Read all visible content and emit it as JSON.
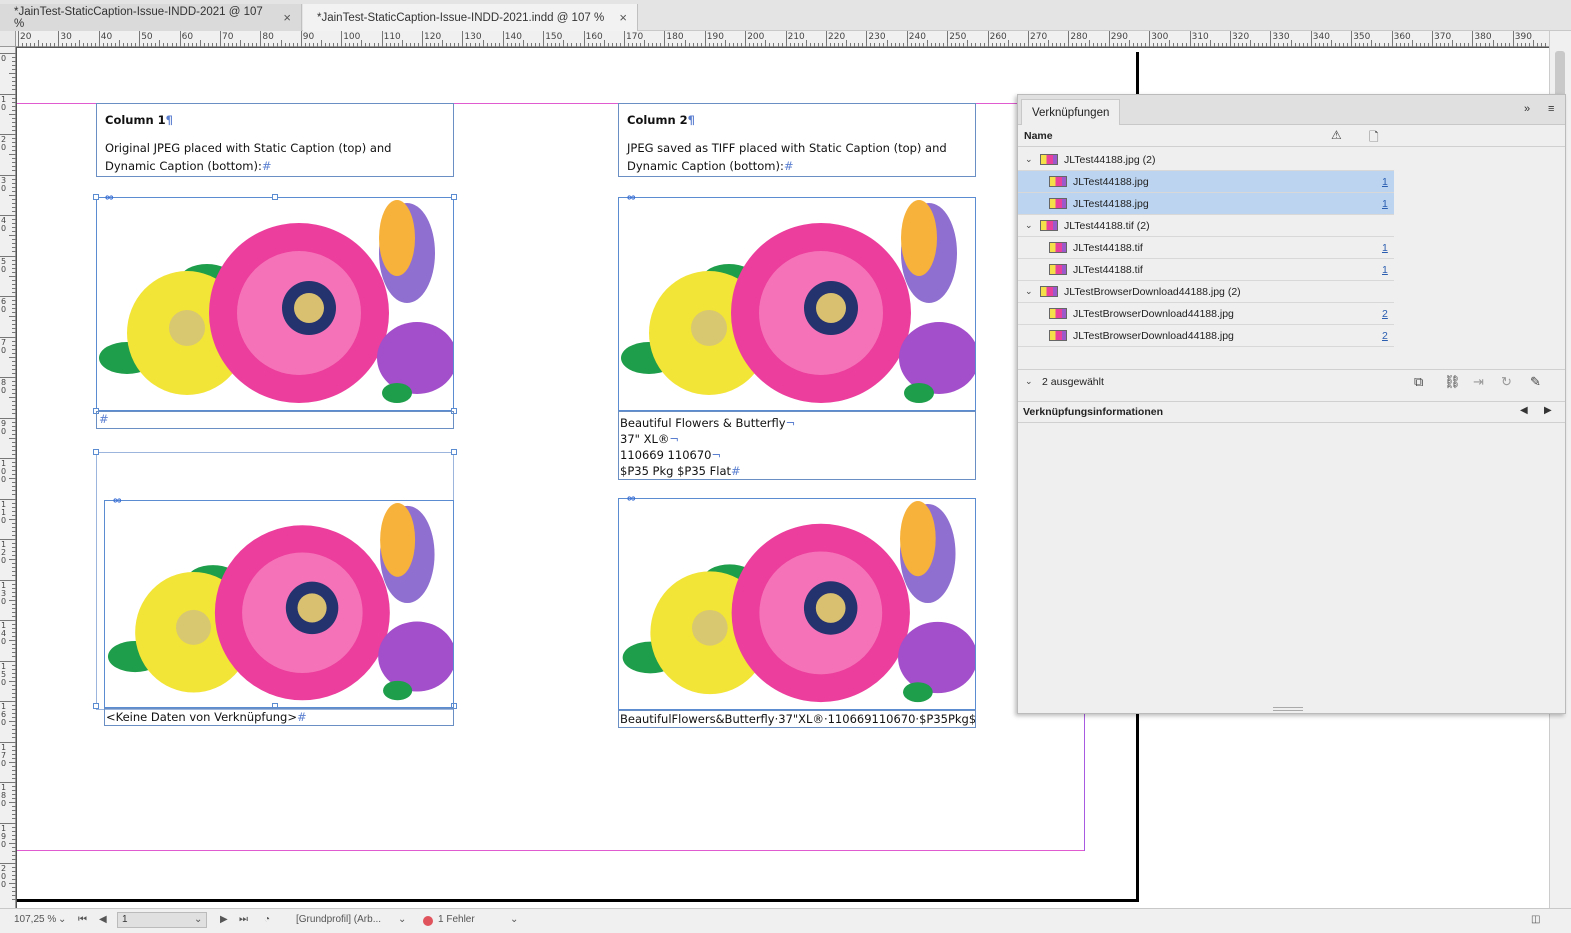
{
  "tabs": [
    {
      "title": "*JainTest-StaticCaption-Issue-INDD-2021 @ 107 %",
      "close": "×"
    },
    {
      "title": "*JainTest-StaticCaption-Issue-INDD-2021.indd @ 107 %",
      "close": "×"
    }
  ],
  "ruler": {
    "h_labels": [
      "20",
      "30",
      "40",
      "50",
      "60",
      "70",
      "80",
      "90",
      "100",
      "110",
      "120",
      "130",
      "140",
      "150",
      "160",
      "170",
      "180",
      "190",
      "200",
      "210",
      "220",
      "230",
      "240",
      "250",
      "260",
      "270",
      "280",
      "290",
      "300",
      "310",
      "320",
      "330",
      "340",
      "350",
      "360",
      "370",
      "380",
      "390"
    ],
    "v_labels": [
      "0",
      "1\n0",
      "2\n0",
      "3\n0",
      "4\n0",
      "5\n0",
      "6\n0",
      "7\n0",
      "8\n0",
      "9\n0",
      "1\n0\n0",
      "1\n1\n0",
      "1\n2\n0",
      "1\n3\n0",
      "1\n4\n0",
      "1\n5\n0",
      "1\n6\n0",
      "1\n7\n0",
      "1\n8\n0",
      "1\n9\n0",
      "2\n0\n0"
    ]
  },
  "document": {
    "col1": {
      "heading": "Column 1",
      "body": "Original JPEG placed with Static Caption (top) and Dynamic Caption (bottom):",
      "static_caption": "#",
      "dynamic_caption": "<Keine Daten von Verknüpfung>"
    },
    "col2": {
      "heading": "Column 2",
      "body": "JPEG saved as TIFF placed with Static Caption (top) and Dynamic Caption (bottom):",
      "static_caption_lines": [
        "Beautiful Flowers & Butterfly",
        "37\" XL®",
        "110669 110670",
        "$P35 Pkg $P35 Flat"
      ],
      "dynamic_caption": "BeautifulFlowers&Butterfly·37\"XL®·110669110670·$P35Pkg$P35Flat"
    }
  },
  "links_panel": {
    "title": "Verknüpfungen",
    "menu_double": "»",
    "menu_icon": "≡",
    "column_name": "Name",
    "rows": [
      {
        "level": 0,
        "label": "JLTest44188.jpg (2)",
        "page": "",
        "selected": false,
        "expanded": true
      },
      {
        "level": 1,
        "label": "JLTest44188.jpg",
        "page": "1",
        "selected": true
      },
      {
        "level": 1,
        "label": "JLTest44188.jpg",
        "page": "1",
        "selected": true
      },
      {
        "level": 0,
        "label": "JLTest44188.tif (2)",
        "page": "",
        "selected": false,
        "expanded": true
      },
      {
        "level": 1,
        "label": "JLTest44188.tif",
        "page": "1",
        "selected": false
      },
      {
        "level": 1,
        "label": "JLTest44188.tif",
        "page": "1",
        "selected": false
      },
      {
        "level": 0,
        "label": "JLTestBrowserDownload44188.jpg (2)",
        "page": "",
        "selected": false,
        "expanded": true
      },
      {
        "level": 1,
        "label": "JLTestBrowserDownload44188.jpg",
        "page": "2",
        "selected": false
      },
      {
        "level": 1,
        "label": "JLTestBrowserDownload44188.jpg",
        "page": "2",
        "selected": false
      }
    ],
    "selection_count": "2 ausgewählt",
    "info_title": "Verknüpfungsinformationen"
  },
  "statusbar": {
    "zoom": "107,25 %",
    "page": "1",
    "profile": "[Grundprofil] (Arb...",
    "errors": "1 Fehler"
  },
  "colors": {
    "guide_magenta": "#e05ad0",
    "frame_blue": "#5b8bd0",
    "selection_blue": "#bcd4f0",
    "error_red": "#e0535c"
  }
}
